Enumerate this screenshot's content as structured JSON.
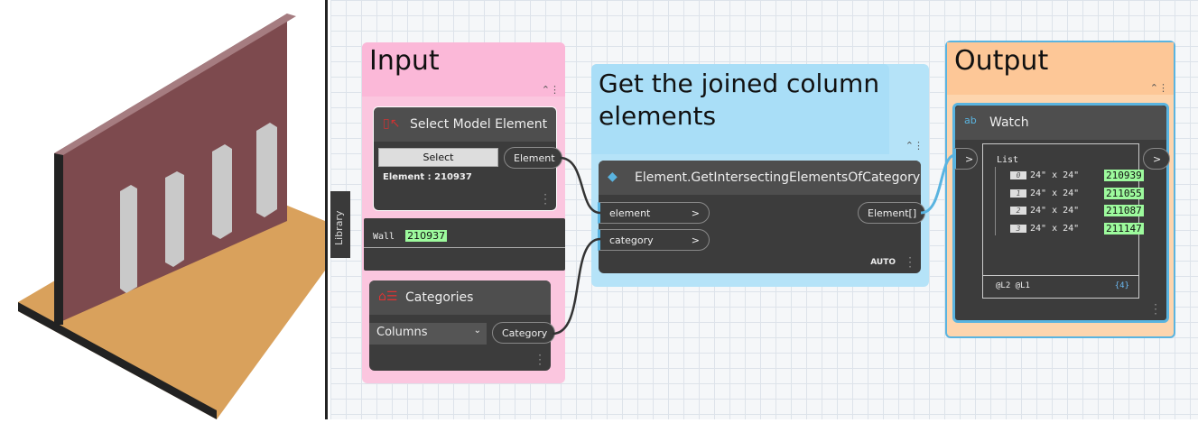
{
  "library_label": "Library",
  "groups": {
    "input": "Input",
    "middle": "Get the joined column elements",
    "output": "Output"
  },
  "select_node": {
    "title": "Select Model Element",
    "button": "Select",
    "output": "Element",
    "info": "Element : 210937"
  },
  "wall_watch": {
    "label": "Wall",
    "value": "210937"
  },
  "categories_node": {
    "title": "Categories",
    "selected": "Columns",
    "output": "Category"
  },
  "intersect_node": {
    "title": "Element.GetIntersectingElementsOfCategory",
    "inputs": [
      "element",
      "category"
    ],
    "input_arrow": ">",
    "output": "Element[]",
    "lacing": "AUTO"
  },
  "watch_node": {
    "title": "Watch",
    "in_port": ">",
    "out_port": ">",
    "list_label": "List",
    "items": [
      {
        "index": "0",
        "label": "24\" x 24\"",
        "id": "210939"
      },
      {
        "index": "1",
        "label": "24\" x 24\"",
        "id": "211055"
      },
      {
        "index": "2",
        "label": "24\" x 24\"",
        "id": "211087"
      },
      {
        "index": "3",
        "label": "24\" x 24\"",
        "id": "211147"
      }
    ],
    "levels": "@L2 @L1",
    "count": "{4}"
  },
  "colors": {
    "input": "#fbbfdc",
    "middle": "#a9def7",
    "output": "#fdc797",
    "wire_blue": "#5ab4e0"
  }
}
